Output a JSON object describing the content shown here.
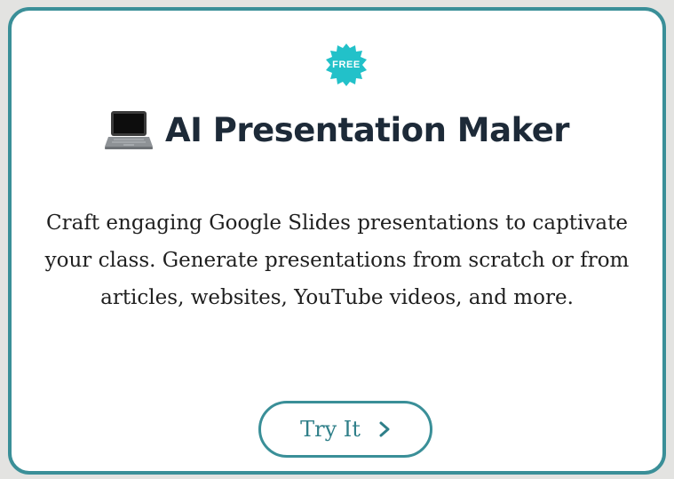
{
  "badge": {
    "label": "FREE",
    "color": "#22c1c9"
  },
  "header": {
    "icon": "laptop-icon",
    "title": "AI Presentation Maker"
  },
  "description": "Craft engaging Google Slides presentations to captivate your class. Generate presentations from scratch or from articles, websites, YouTube videos, and more.",
  "cta": {
    "label": "Try It",
    "icon": "chevron-right-icon"
  },
  "colors": {
    "accent": "#3a8f98",
    "title": "#1d2a38",
    "badge": "#22c1c9"
  }
}
